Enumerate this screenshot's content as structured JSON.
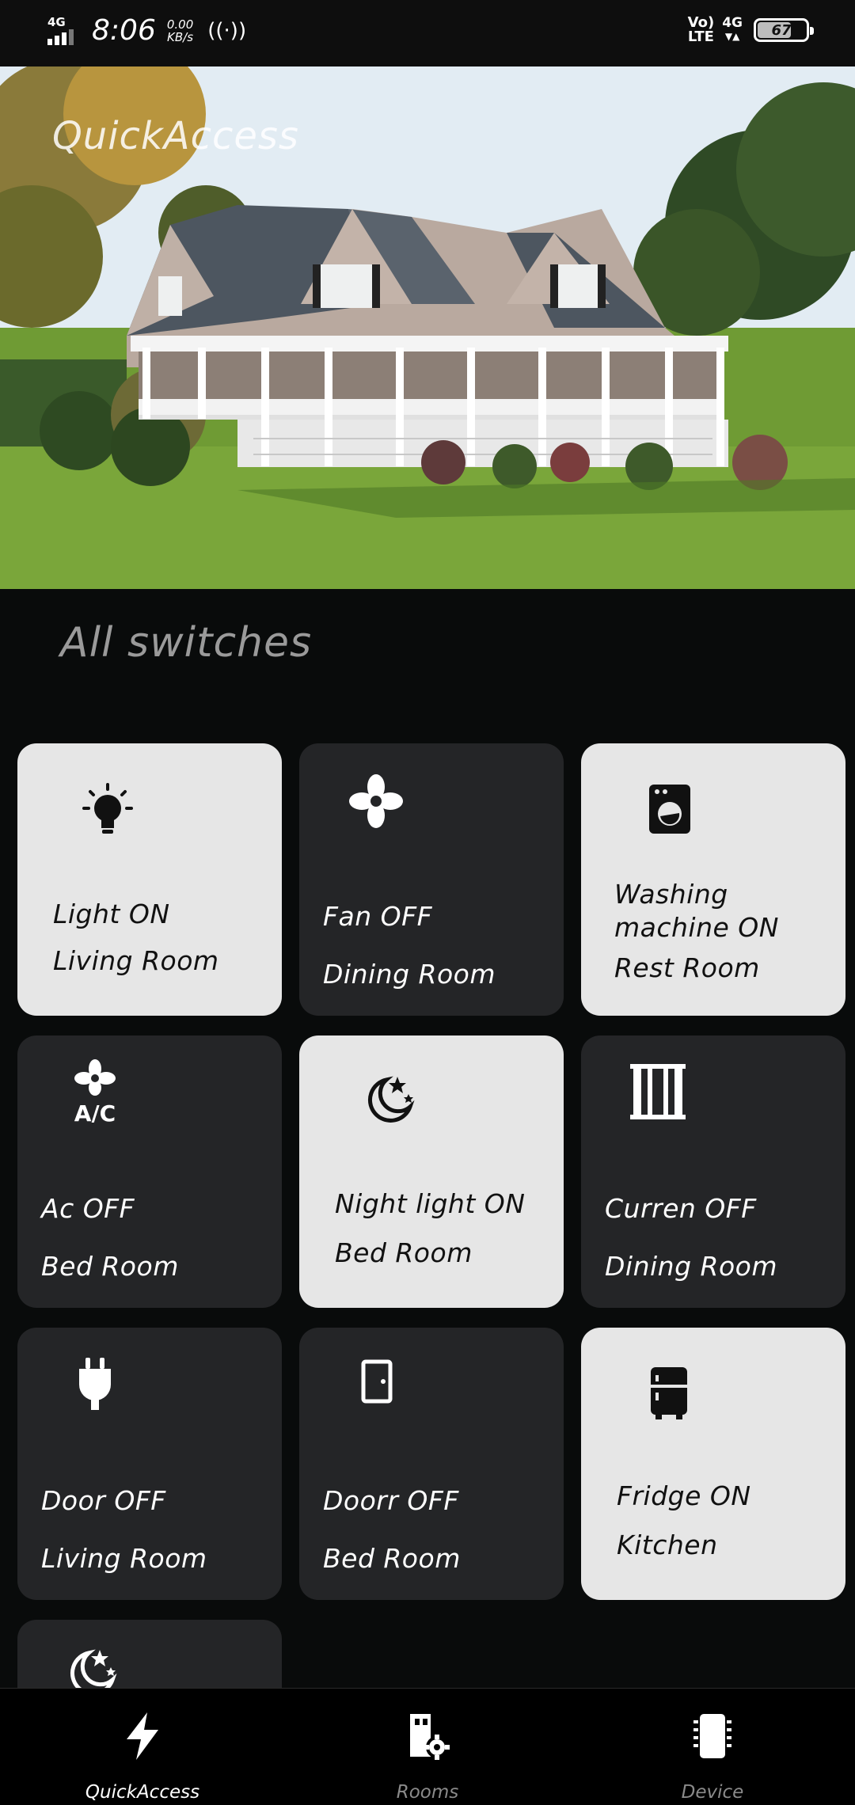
{
  "status_bar": {
    "signal_label": "4G",
    "time": "8:06",
    "speed_value": "0.00",
    "speed_unit": "KB/s",
    "volte_top": "Vo)",
    "volte_bottom": "LTE",
    "network": "4G",
    "battery": "67"
  },
  "hero": {
    "title": "QuickAccess"
  },
  "section_title": "All switches",
  "switches": [
    {
      "name": "Light ON",
      "room": "Living Room",
      "state": "on",
      "icon": "lightbulb-icon"
    },
    {
      "name": "Fan OFF",
      "room": "Dining Room",
      "state": "off",
      "icon": "fan-icon"
    },
    {
      "name": "Washing machine  ON",
      "room": "Rest Room",
      "state": "on",
      "icon": "washing-machine-icon"
    },
    {
      "name": "Ac OFF",
      "room": "Bed Room",
      "state": "off",
      "icon": "air-conditioner-icon"
    },
    {
      "name": "Night light ON",
      "room": "Bed Room",
      "state": "on",
      "icon": "night-moon-icon"
    },
    {
      "name": "Curren OFF",
      "room": "Dining Room",
      "state": "off",
      "icon": "curtain-icon"
    },
    {
      "name": "Door OFF",
      "room": "Living Room",
      "state": "off",
      "icon": "plug-icon"
    },
    {
      "name": "Doorr OFF",
      "room": "Bed Room",
      "state": "off",
      "icon": "door-icon"
    },
    {
      "name": "Fridge ON",
      "room": "Kitchen",
      "state": "on",
      "icon": "fridge-icon"
    },
    {
      "name": "",
      "room": "",
      "state": "off",
      "icon": "night-moon-icon"
    }
  ],
  "bottom_nav": [
    {
      "label": "QuickAccess",
      "icon": "lightning-icon",
      "active": true
    },
    {
      "label": "Rooms",
      "icon": "rooms-settings-icon",
      "active": false
    },
    {
      "label": "Device",
      "icon": "device-chip-icon",
      "active": false
    }
  ],
  "colors": {
    "background": "#090b0b",
    "card_off": "#242527",
    "card_on": "#e6e6e6",
    "nav_active": "#ffffff",
    "nav_inactive": "#8a8a8a"
  }
}
